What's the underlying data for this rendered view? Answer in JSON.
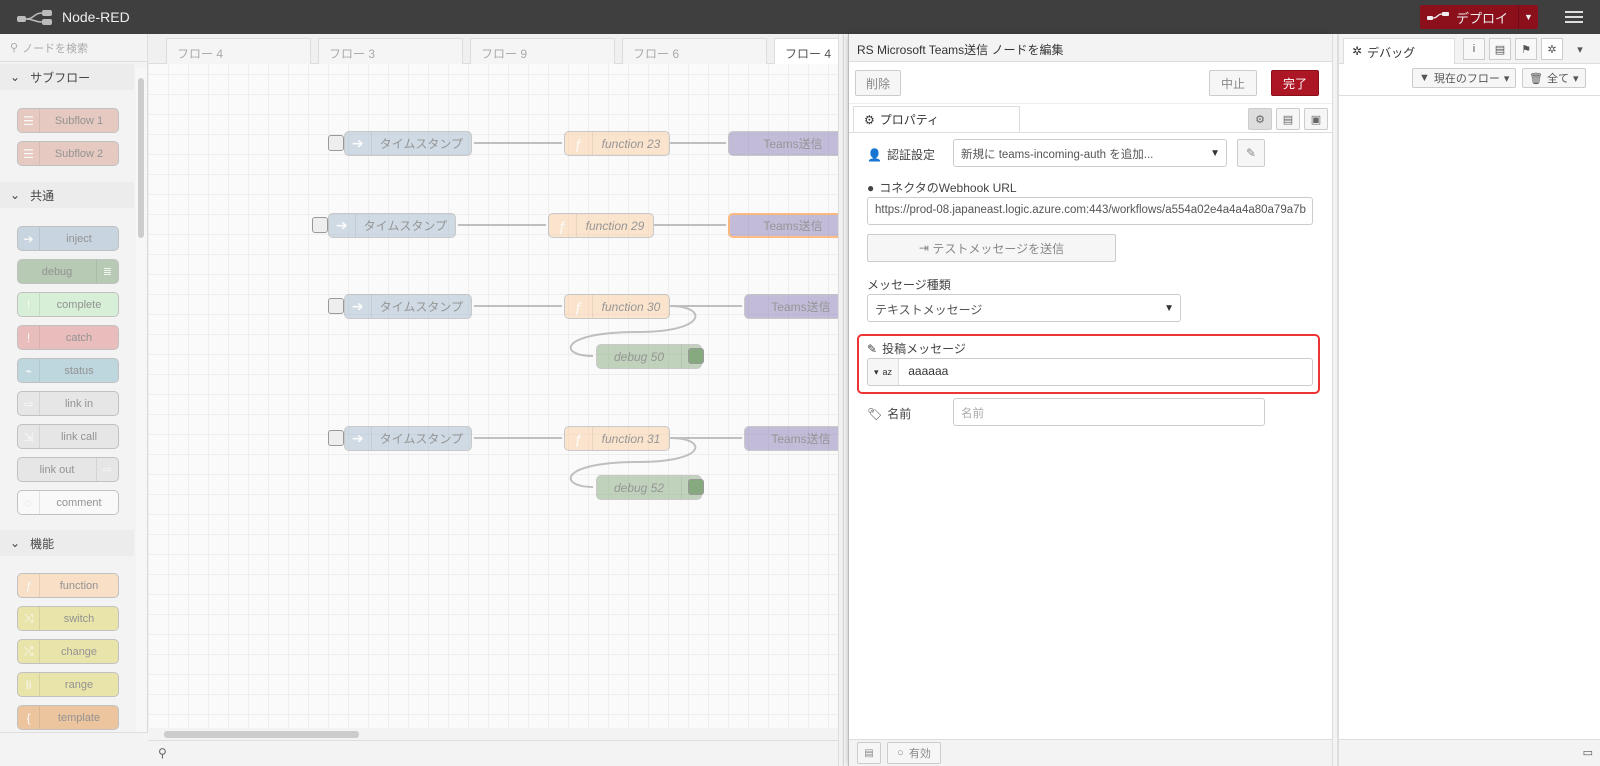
{
  "app": {
    "title": "Node-RED",
    "deploy_label": "デプロイ"
  },
  "palette": {
    "search_placeholder": "ノードを検索",
    "categories": [
      {
        "label": "サブフロー",
        "nodes": [
          "Subflow 1",
          "Subflow 2"
        ]
      },
      {
        "label": "共通",
        "nodes": [
          "inject",
          "debug",
          "complete",
          "catch",
          "status",
          "link in",
          "link call",
          "link out",
          "comment"
        ]
      },
      {
        "label": "機能",
        "nodes": [
          "function",
          "switch",
          "change",
          "range",
          "template"
        ]
      }
    ],
    "colors": {
      "subflow": "#ddaa99",
      "inject": "#a6bbcf",
      "debug": "#87a980",
      "complete": "#c0edc0",
      "catch": "#e49191",
      "status": "#94c1d0",
      "link": "#dddddd",
      "comment": "#ffffff",
      "function": "#fdd0a2",
      "switch": "#e2d96e"
    }
  },
  "workspace": {
    "tabs": [
      "フロー 4",
      "フロー 3",
      "フロー 9",
      "フロー 6",
      "フロー 4"
    ],
    "nodes": {
      "ts1": "タイムスタンプ",
      "fn23": "function 23",
      "teams1": "Teams送信",
      "ts2": "タイムスタンプ",
      "fn29": "function 29",
      "teams2": "Teams送信",
      "ts3": "タイムスタンプ",
      "fn30": "function 30",
      "teams3": "Teams送信",
      "debug50": "debug 50",
      "ts4": "タイムスタンプ",
      "fn31": "function 31",
      "teams4": "Teams送信",
      "debug52": "debug 52"
    }
  },
  "tray": {
    "title": "RS Microsoft Teams送信 ノードを編集",
    "delete_label": "削除",
    "cancel_label": "中止",
    "done_label": "完了",
    "properties_tab": "プロパティ",
    "auth_label": "認証設定",
    "auth_value": "新規に teams-incoming-auth を追加...",
    "webhook_label": "コネクタのWebhook URL",
    "webhook_value": "https://prod-08.japaneast.logic.azure.com:443/workflows/a554a02e4a4a4a80a79a7b",
    "test_button": "テストメッセージを送信",
    "msgtype_label": "メッセージ種類",
    "msgtype_value": "テキストメッセージ",
    "post_label": "投稿メッセージ",
    "post_type_icon": "az",
    "post_value": "aaaaaa",
    "name_label": "名前",
    "name_placeholder": "名前",
    "enabled_label": "有効"
  },
  "sidebar": {
    "debug_tab": "デバッグ",
    "filter_current": "現在のフロー",
    "filter_all": "全て"
  }
}
